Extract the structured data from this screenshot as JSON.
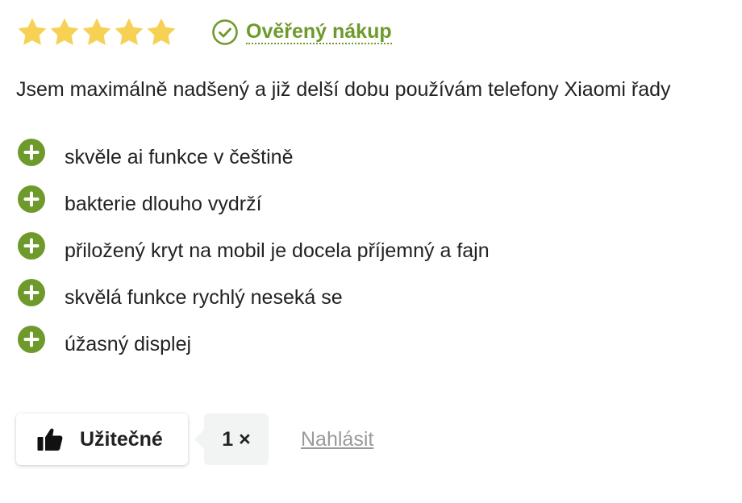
{
  "review": {
    "rating": 5,
    "rating_max": 5,
    "star_color": "#f7d154",
    "verified": {
      "icon": "check-circle-icon",
      "label": "Ověřený nákup",
      "color": "#6d9a2b"
    },
    "text": "Jsem maximálně nadšený a již delší dobu používám telefony Xiaomi řady",
    "pros_icon": "plus-circle-icon",
    "pros": [
      "skvěle ai funkce v češtině",
      "bakterie dlouho vydrží",
      "přiložený kryt na mobil je docela příjemný a fajn",
      "skvělá funkce rychlý neseká se",
      "úžasný displej"
    ]
  },
  "actions": {
    "useful_icon": "thumbs-up-icon",
    "useful_label": "Užitečné",
    "useful_count": "1 ×",
    "report_label": "Nahlásit"
  }
}
